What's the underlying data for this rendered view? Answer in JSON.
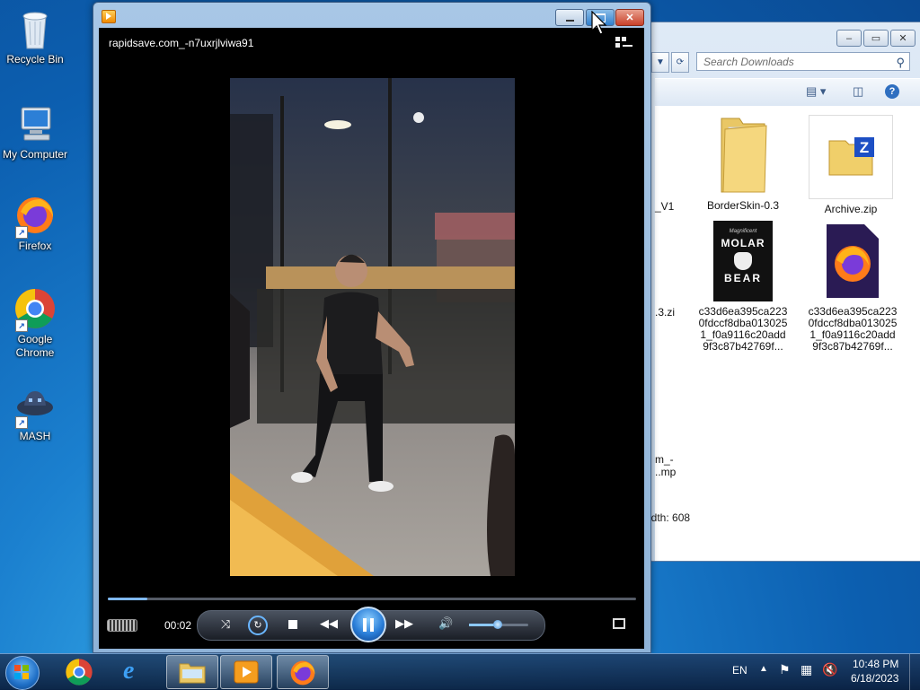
{
  "desktop": {
    "icons": [
      {
        "label": "Recycle Bin"
      },
      {
        "label": "My Computer"
      },
      {
        "label": "Firefox"
      },
      {
        "label": "Google Chrome"
      },
      {
        "label": "MASH"
      }
    ]
  },
  "explorer": {
    "search_placeholder": "Search Downloads",
    "files": [
      {
        "label": "BorderSkin-0.3"
      },
      {
        "label": "Archive.zip"
      },
      {
        "label": "c33d6ea395ca2230fdccf8dba0130251_f0a9116c20add9f3c87b42769f..."
      },
      {
        "label": "c33d6ea395ca2230fdccf8dba0130251_f0a9116c20add9f3c87b42769f..."
      }
    ],
    "partial_labels": [
      "_V1",
      ".3.zi",
      "m_-",
      "..mp"
    ],
    "status_partial": "idth: 608",
    "molar_line1": "MOLAR",
    "molar_line2": "BEAR",
    "molar_top": "Magnificent"
  },
  "player": {
    "video_title": "rapidsave.com_-n7uxrjlviwa91",
    "time": "00:02",
    "progress": 0.075,
    "volume": 0.48
  },
  "taskbar": {
    "language": "EN",
    "clock_time": "10:48 PM",
    "clock_date": "6/18/2023"
  }
}
